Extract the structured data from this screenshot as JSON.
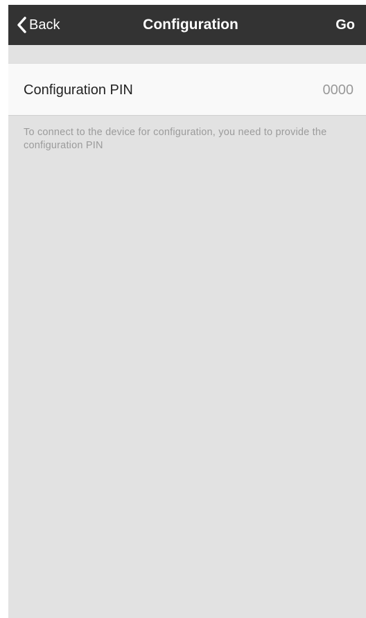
{
  "navbar": {
    "back_label": "Back",
    "title": "Configuration",
    "action_label": "Go",
    "icons": {
      "back": "chevron-left-icon"
    }
  },
  "config_pin": {
    "label": "Configuration PIN",
    "value": "0000"
  },
  "footnote": "To connect to the device for configuration, you need to provide the configuration PIN",
  "colors": {
    "navbar_bg": "#333333",
    "background": "#e2e2e2",
    "row_bg": "#f9f9f9",
    "secondary_text": "#999999"
  }
}
